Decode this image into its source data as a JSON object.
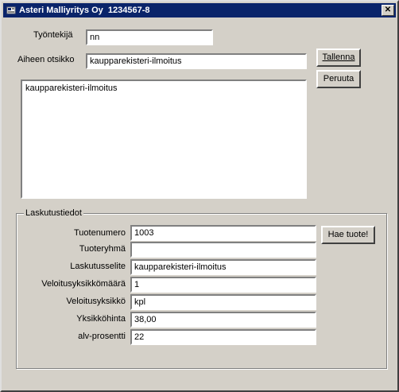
{
  "window": {
    "title": "Asteri Malliyritys Oy  1234567-8",
    "close_glyph": "✕"
  },
  "form": {
    "employee_label": "Työntekijä",
    "employee_value": "nn",
    "subject_label": "Aiheen otsikko",
    "subject_value": "kaupparekisteri-ilmoitus",
    "body_text": "kaupparekisteri-ilmoitus",
    "save_button": "Tallenna",
    "cancel_button": "Peruuta"
  },
  "billing": {
    "group_title": "Laskutustiedot",
    "fetch_button": "Hae tuote!",
    "fields": [
      {
        "label": "Tuotenumero",
        "value": "1003"
      },
      {
        "label": "Tuoteryhmä",
        "value": ""
      },
      {
        "label": "Laskutusselite",
        "value": "kaupparekisteri-ilmoitus"
      },
      {
        "label": "Veloitusyksikkömäärä",
        "value": "1"
      },
      {
        "label": "Veloitusyksikkö",
        "value": "kpl"
      },
      {
        "label": "Yksikköhinta",
        "value": "38,00"
      },
      {
        "label": "alv-prosentti",
        "value": "22"
      }
    ]
  }
}
